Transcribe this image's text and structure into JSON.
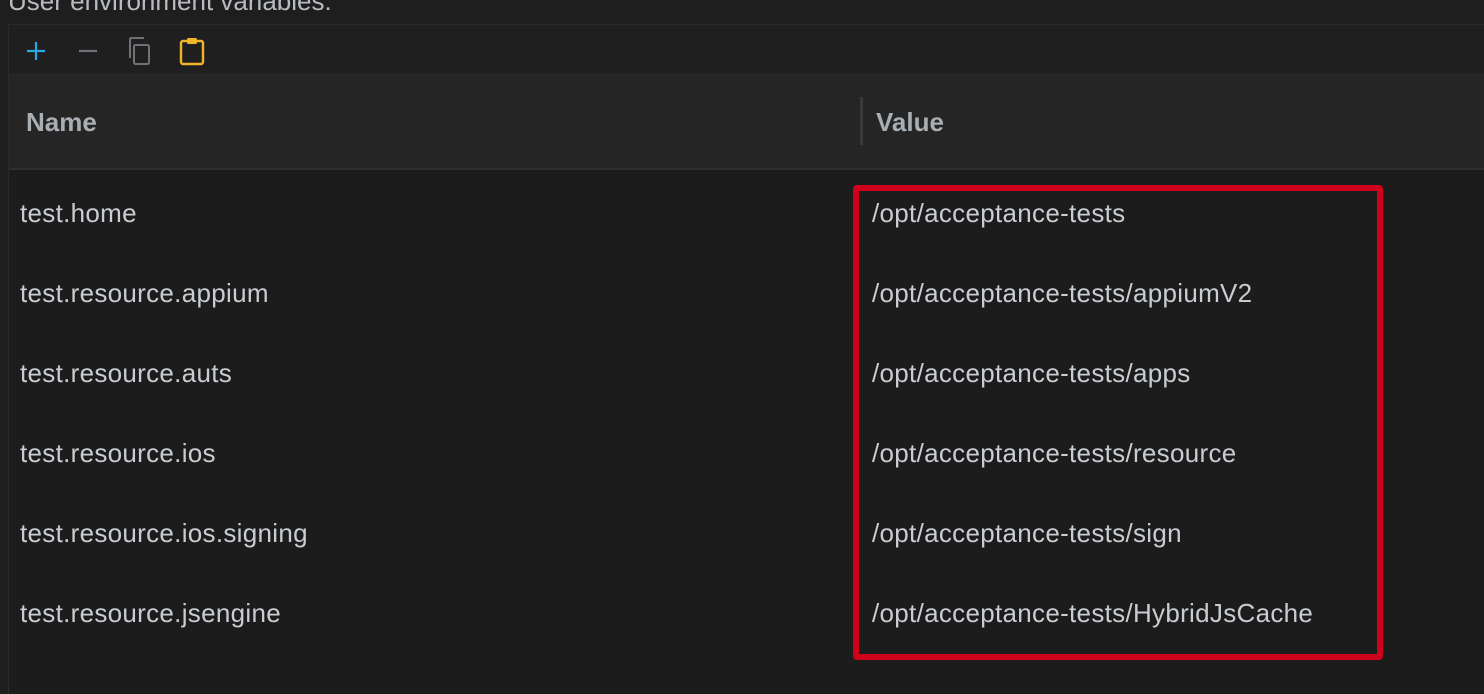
{
  "section": {
    "label": "User environment variables:"
  },
  "toolbar": {
    "add_icon": "plus-icon",
    "remove_icon": "minus-icon",
    "copy_icon": "copy-icon",
    "paste_icon": "clipboard-icon",
    "add_color": "#29a8e0",
    "paste_color": "#f0b429"
  },
  "table": {
    "columns": [
      "Name",
      "Value"
    ],
    "rows": [
      {
        "name": "test.home",
        "value": "/opt/acceptance-tests"
      },
      {
        "name": "test.resource.appium",
        "value": "/opt/acceptance-tests/appiumV2"
      },
      {
        "name": "test.resource.auts",
        "value": "/opt/acceptance-tests/apps"
      },
      {
        "name": "test.resource.ios",
        "value": "/opt/acceptance-tests/resource"
      },
      {
        "name": "test.resource.ios.signing",
        "value": "/opt/acceptance-tests/sign"
      },
      {
        "name": "test.resource.jsengine",
        "value": "/opt/acceptance-tests/HybridJsCache"
      }
    ]
  },
  "annotation": {
    "color": "#d0021b"
  }
}
